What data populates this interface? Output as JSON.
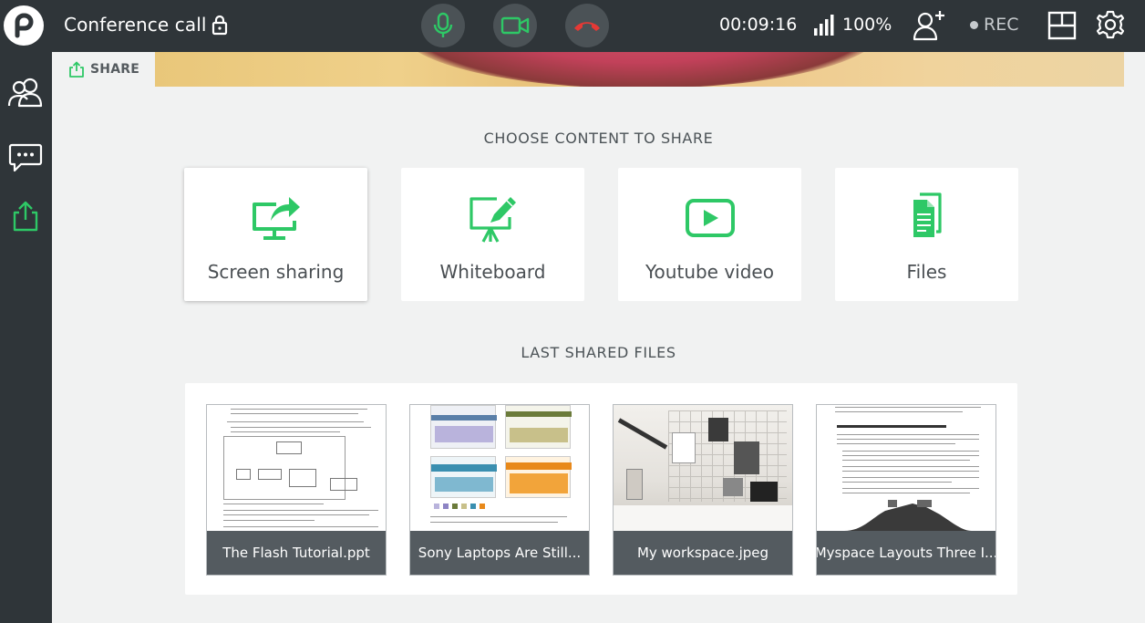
{
  "header": {
    "title": "Conference call",
    "timer": "00:09:16",
    "signal_label": "100%",
    "rec_label": "REC"
  },
  "tab": {
    "label": "SHARE"
  },
  "share": {
    "heading": "CHOOSE CONTENT TO SHARE",
    "options": [
      {
        "label": "Screen sharing",
        "icon": "screen-share-icon"
      },
      {
        "label": "Whiteboard",
        "icon": "whiteboard-icon"
      },
      {
        "label": "Youtube video",
        "icon": "youtube-icon"
      },
      {
        "label": "Files",
        "icon": "files-icon"
      }
    ]
  },
  "files": {
    "heading": "LAST SHARED FILES",
    "items": [
      {
        "name": "The Flash Tutorial.ppt"
      },
      {
        "name": "Sony Laptops Are Still..."
      },
      {
        "name": "My workspace.jpeg"
      },
      {
        "name": "Myspace Layouts Three I..."
      }
    ]
  },
  "colors": {
    "accent_green": "#2ec866",
    "topbar": "#2f3539",
    "end_call_red": "#e53935"
  }
}
